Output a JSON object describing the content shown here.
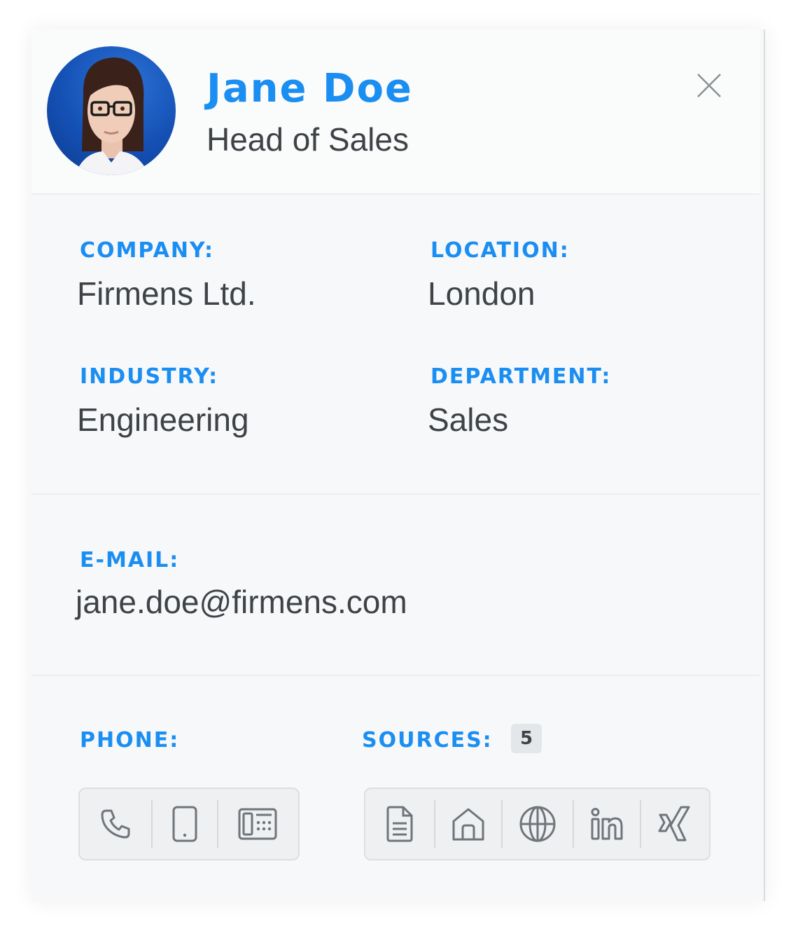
{
  "contact": {
    "name": "Jane Doe",
    "title": "Head of Sales"
  },
  "fields": {
    "company": {
      "label": "COMPANY:",
      "value": "Firmens Ltd."
    },
    "location": {
      "label": "LOCATION:",
      "value": "London"
    },
    "industry": {
      "label": "INDUSTRY:",
      "value": "Engineering"
    },
    "department": {
      "label": "DEPARTMENT:",
      "value": "Sales"
    },
    "email": {
      "label": "E-MAIL:",
      "value": "jane.doe@firmens.com"
    }
  },
  "phone": {
    "label": "PHONE:",
    "icons": [
      "phone-icon",
      "mobile-icon",
      "fax-icon"
    ]
  },
  "sources": {
    "label": "SOURCES:",
    "count": "5",
    "icons": [
      "document-icon",
      "home-icon",
      "globe-icon",
      "linkedin-icon",
      "xing-icon"
    ]
  },
  "colors": {
    "accent": "#1b8ef2",
    "text": "#3f4347",
    "icon": "#6f757b",
    "card_bg": "#f7f8f9"
  }
}
